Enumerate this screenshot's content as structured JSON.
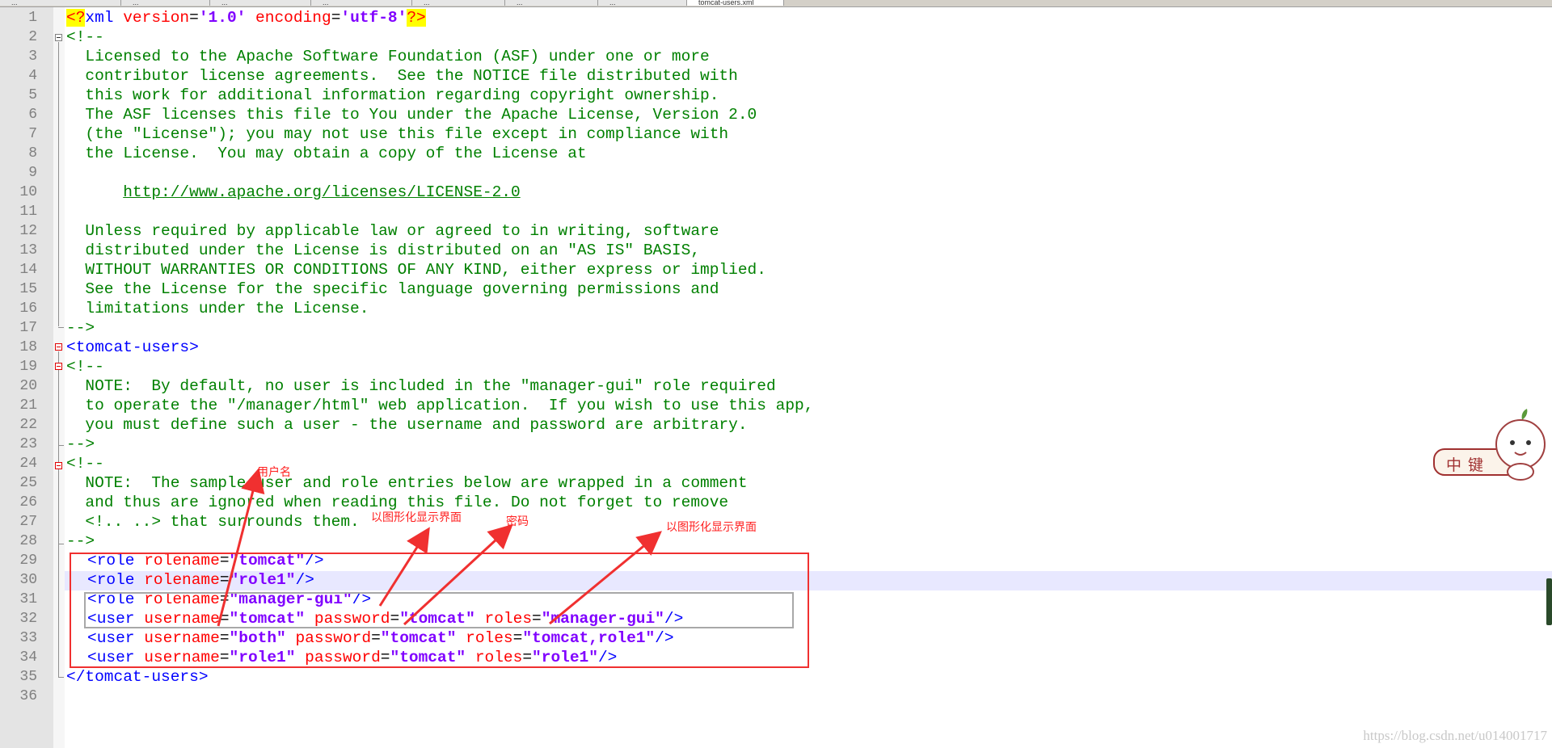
{
  "tabs": [
    "...",
    "...",
    "...",
    "...",
    "...",
    "...",
    "...",
    "tomcat-users.xml"
  ],
  "line_numbers": [
    "1",
    "2",
    "3",
    "4",
    "5",
    "6",
    "7",
    "8",
    "9",
    "10",
    "11",
    "12",
    "13",
    "14",
    "15",
    "16",
    "17",
    "18",
    "19",
    "20",
    "21",
    "22",
    "23",
    "24",
    "25",
    "26",
    "27",
    "28",
    "29",
    "30",
    "31",
    "32",
    "33",
    "34",
    "35",
    "36"
  ],
  "code": {
    "l1": {
      "pi_open": "<?",
      "name": "xml",
      "a1": " version",
      "a1v": "'1.0'",
      "a2": " encoding",
      "a2v": "'utf-8'",
      "pi_close": "?>"
    },
    "l2": "<!--",
    "l3": "  Licensed to the Apache Software Foundation (ASF) under one or more",
    "l4": "  contributor license agreements.  See the NOTICE file distributed with",
    "l5": "  this work for additional information regarding copyright ownership.",
    "l6": "  The ASF licenses this file to You under the Apache License, Version 2.0",
    "l7": "  (the \"License\"); you may not use this file except in compliance with",
    "l8": "  the License.  You may obtain a copy of the License at",
    "l10_indent": "      ",
    "l10_url": "http://www.apache.org/licenses/LICENSE-2.0",
    "l12": "  Unless required by applicable law or agreed to in writing, software",
    "l13": "  distributed under the License is distributed on an \"AS IS\" BASIS,",
    "l14": "  WITHOUT WARRANTIES OR CONDITIONS OF ANY KIND, either express or implied.",
    "l15": "  See the License for the specific language governing permissions and",
    "l16": "  limitations under the License.",
    "l17": "-->",
    "l18": "<tomcat-users>",
    "l19": "<!--",
    "l20": "  NOTE:  By default, no user is included in the \"manager-gui\" role required",
    "l21": "  to operate the \"/manager/html\" web application.  If you wish to use this app,",
    "l22": "  you must define such a user - the username and password are arbitrary.",
    "l23": "-->",
    "l24": "<!--",
    "l25": "  NOTE:  The sample user and role entries below are wrapped in a comment",
    "l26": "  and thus are ignored when reading this file. Do not forget to remove",
    "l27": "  <!.. ..> that surrounds them.",
    "l28": "-->",
    "l35": "</tomcat-users>"
  },
  "roles": [
    {
      "rolename": "\"tomcat\""
    },
    {
      "rolename": "\"role1\""
    },
    {
      "rolename": "\"manager-gui\""
    }
  ],
  "users": [
    {
      "username": "\"tomcat\"",
      "password": "\"tomcat\"",
      "roles": "\"manager-gui\""
    },
    {
      "username": "\"both\"",
      "password": "\"tomcat\"",
      "roles": "\"tomcat,role1\""
    },
    {
      "username": "\"role1\"",
      "password": "\"tomcat\"",
      "roles": "\"role1\""
    }
  ],
  "tokens": {
    "role_tag": "<role",
    "user_tag": "<user",
    "close": "/>",
    "attr_rolename": " rolename",
    "attr_username": " username",
    "attr_password": " password",
    "attr_roles": " roles",
    "eq": "="
  },
  "annotations": {
    "username_note": "用户名",
    "gui_note_1": "以图形化显示界面",
    "password_note": "密码",
    "gui_note_2": "以图形化显示界面"
  },
  "ime": {
    "label": "中键"
  },
  "watermark": "https://blog.csdn.net/u014001717",
  "colors": {
    "comment": "#008000",
    "tag": "#0000ff",
    "attribute": "#ff0000",
    "value": "#8000ff",
    "annotation": "#ff2020"
  }
}
